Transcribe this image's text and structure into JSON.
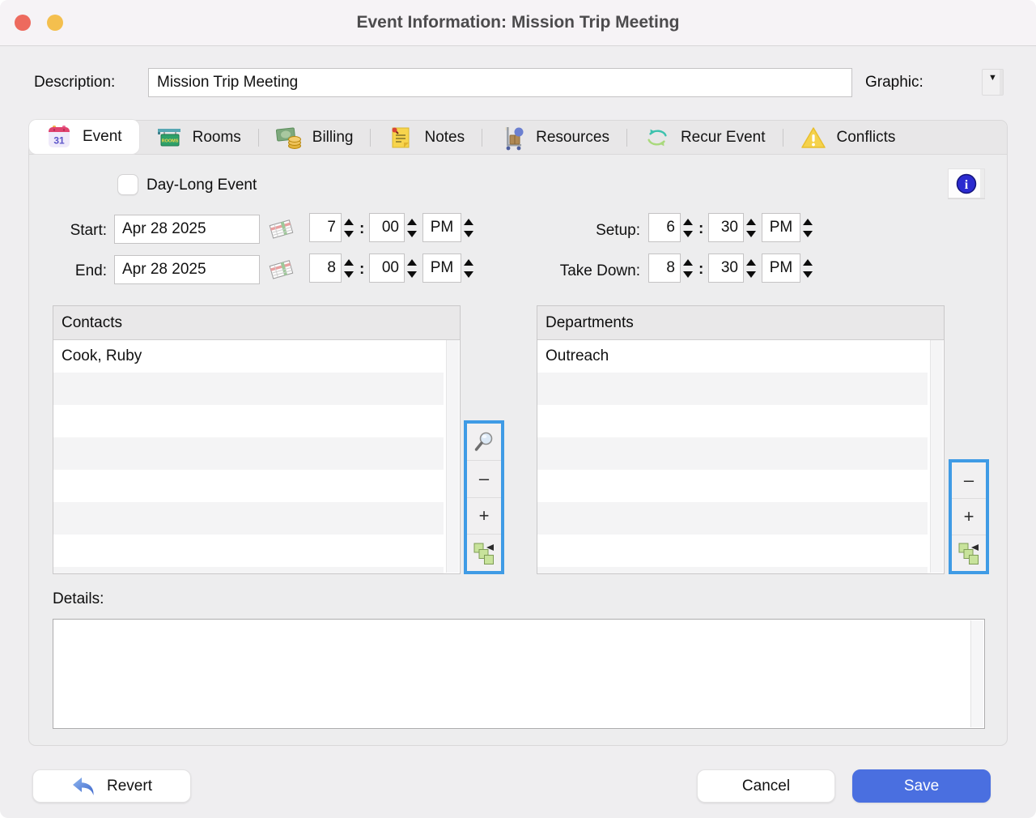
{
  "window": {
    "title": "Event Information: Mission Trip Meeting"
  },
  "description": {
    "label": "Description:",
    "value": "Mission Trip Meeting"
  },
  "graphic": {
    "label": "Graphic:",
    "dropdown_glyph": "▼"
  },
  "tabs": [
    {
      "label": "Event",
      "icon": "calendar-31-icon",
      "active": true
    },
    {
      "label": "Rooms",
      "icon": "rooms-sign-icon",
      "active": false
    },
    {
      "label": "Billing",
      "icon": "money-icon",
      "active": false
    },
    {
      "label": "Notes",
      "icon": "note-icon",
      "active": false
    },
    {
      "label": "Resources",
      "icon": "hand-truck-icon",
      "active": false
    },
    {
      "label": "Recur Event",
      "icon": "recur-arrows-icon",
      "active": false
    },
    {
      "label": "Conflicts",
      "icon": "warning-icon",
      "active": false
    }
  ],
  "event_tab": {
    "day_long_label": "Day-Long Event",
    "day_long_checked": false,
    "time_separator": ":",
    "start": {
      "label": "Start:",
      "date": "Apr 28 2025",
      "hour": "7",
      "minute": "00",
      "ampm": "PM"
    },
    "end": {
      "label": "End:",
      "date": "Apr 28 2025",
      "hour": "8",
      "minute": "00",
      "ampm": "PM"
    },
    "setup": {
      "label": "Setup:",
      "hour": "6",
      "minute": "30",
      "ampm": "PM"
    },
    "takedown": {
      "label": "Take Down:",
      "hour": "8",
      "minute": "30",
      "ampm": "PM"
    },
    "contacts": {
      "header": "Contacts",
      "rows": [
        "Cook, Ruby"
      ]
    },
    "departments": {
      "header": "Departments",
      "rows": [
        "Outreach"
      ]
    },
    "details_label": "Details:"
  },
  "toolbar": {
    "remove_label": "–",
    "add_label": "+"
  },
  "buttons": {
    "revert": "Revert",
    "cancel": "Cancel",
    "save": "Save"
  },
  "colors": {
    "accent_blue": "#4a6fe0",
    "toolbar_highlight_blue": "#3f9be5",
    "traffic_red": "#ed6a5e",
    "traffic_yellow": "#f4bf4e"
  }
}
